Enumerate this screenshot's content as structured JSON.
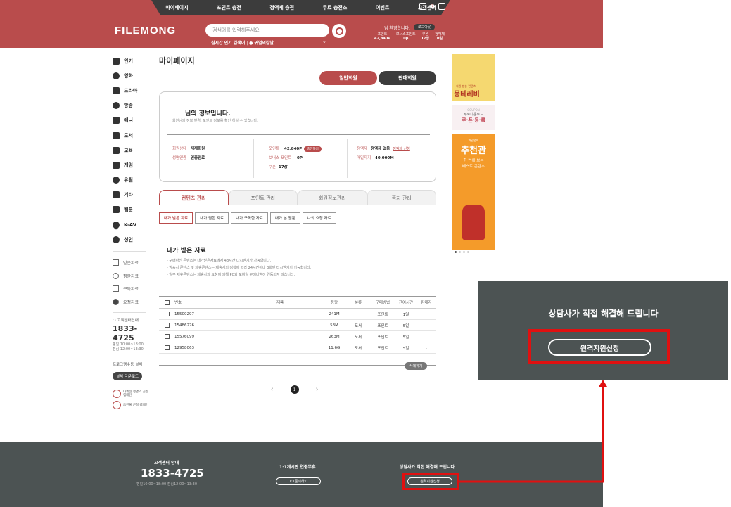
{
  "header": {
    "nav": [
      "마이페이지",
      "포인트 충전",
      "정액제 충전",
      "무료 충전소",
      "이벤트",
      "고객센터"
    ],
    "badge_count": "7",
    "logo": "FILEMONG",
    "search_placeholder": "검색어를 입력해주세요",
    "popular_label": "실시간 인기 검색어",
    "popular_item": "귀멸의칼날",
    "welcome": "님 환영합니다.",
    "logout": "로그아웃",
    "stats": [
      {
        "label": "포인트",
        "value": "42,840P"
      },
      {
        "label": "보너스포인트",
        "value": "0p"
      },
      {
        "label": "쿠폰",
        "value": "17장"
      },
      {
        "label": "정액제",
        "value": "0일"
      }
    ]
  },
  "sidebar": {
    "categories": [
      "인기",
      "영화",
      "드라마",
      "방송",
      "애니",
      "도서",
      "교육",
      "게임",
      "유틸",
      "기타",
      "웹툰",
      "K-AV",
      "성인"
    ],
    "sub": [
      "받은자료",
      "찜한자료",
      "구독자료",
      "요청자료"
    ],
    "cs_label": "고객센터안내",
    "cs_phone": "1833-4725",
    "cs_hours1": "평일 10:00~18:00",
    "cs_hours2": "점심 12:00~13:30",
    "dl_label": "프로그램수동 설치",
    "dl_btn": "설치 다운로드",
    "warn1": "대체널 생명의 근절 캠페인",
    "warn2": "음란물 근절 캠페인"
  },
  "main": {
    "title": "마이페이지",
    "btn_general": "일반회원",
    "btn_seller": "판매회원",
    "info_title": "님의 정보입니다.",
    "info_sub": "회원님의 정보 변경, 포인트 정보를 확인 하실 수 있습니다.",
    "grade_k": "회원상태",
    "grade_v": "제재회원",
    "auth_k": "성명인증",
    "auth_v": "인증완료",
    "point_k": "포인트",
    "point_v": "42,840P",
    "charge": "충전하기",
    "bonus_k": "보너스 포인트",
    "bonus_v": "0P",
    "coupon_k": "쿠폰",
    "coupon_v": "17장",
    "fixed_k": "정액제",
    "fixed_v": "정액제 없음",
    "fixed_link": "정액제 신청",
    "daily_k": "매일자지",
    "daily_v": "40,000M",
    "tabs": [
      "컨텐츠 관리",
      "포인트 관리",
      "회원정보관리",
      "쪽지 관리"
    ],
    "subtabs": [
      "내가 받은 자료",
      "내가 찜한 자료",
      "내가 구독한 자료",
      "내가 본 웹툰",
      "나의 요청 자료"
    ],
    "section_title": "내가 받은 자료",
    "notes": [
      "- 구매하신 콘텐스는 내가받은자료에서 48시간 다시받기가 가능합니다.",
      "- 방송서 콘텐스 및 제휴콘텐스는 제휴사의 정책에 따라 24시간이내 3회만 다시받기가 가능합니다.",
      "- 일부 제휴콘텐스는 제휴사의 요청에 의해 PC외 모바일 구매내역이 연동되지 않습니다."
    ],
    "table_headers": [
      "번호",
      "제목",
      "용량",
      "분류",
      "구매방법",
      "잔여시간",
      "판매자"
    ],
    "rows": [
      {
        "no": "15500297",
        "title": "",
        "size": "241M",
        "cat": "",
        "method": "포인트",
        "left": "1일",
        "seller": ""
      },
      {
        "no": "15486276",
        "title": "",
        "size": "53M",
        "cat": "도서",
        "method": "포인트",
        "left": "5일",
        "seller": ""
      },
      {
        "no": "15576099",
        "title": "",
        "size": "263M",
        "cat": "도서",
        "method": "포인트",
        "left": "5일",
        "seller": ""
      },
      {
        "no": "12958063",
        "title": "",
        "size": "11.6G",
        "cat": "도서",
        "method": "포인트",
        "left": "5일",
        "seller": "."
      }
    ],
    "delete_btn": "삭제하기",
    "pager_prev": "‹",
    "pager_cur": "1",
    "pager_next": "›"
  },
  "banner": {
    "b1_sub": "회원 방송 컨텐츠",
    "b1_title": "몽테레비",
    "b2_s1": "COUPON",
    "b2_s2": "무료다운로드",
    "b2_s3": "쿠·폰·등·록",
    "b3_s0": "파일몽의",
    "b3_title": "추천관",
    "b3_s2a": "한 번에 보는",
    "b3_s2b": "베스트 콘텐츠"
  },
  "footer": {
    "cs_title": "고객센터 안내",
    "phone": "1833-4725",
    "hours": "평일10:00~18:00 점심12:00~13:30",
    "qa_title": "1:1게시판 연중무휴",
    "qa_btn": "1:1문의하기",
    "remote_title": "상담사가 직접 해결해 드립니다",
    "remote_btn": "원격지원신청"
  },
  "popup": {
    "title": "상담사가 직접 해결해 드립니다",
    "button": "원격지원신청"
  },
  "colors": {
    "brand": "#b94c4c",
    "dark": "#3c3c3c",
    "footer": "#4c5353",
    "highlight": "#e01010"
  }
}
